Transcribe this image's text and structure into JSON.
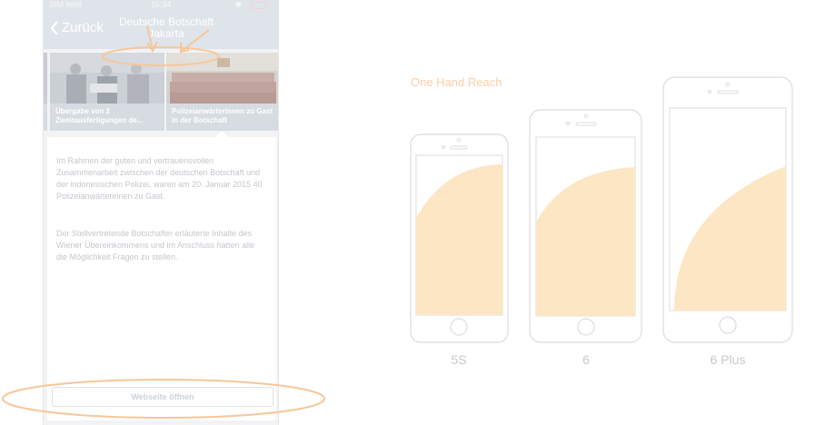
{
  "status_bar": {
    "carrier": "SIM fehlt",
    "time": "15:34"
  },
  "nav": {
    "back_label": "Zurück",
    "title": "Deutsche Botschaft Jakarta"
  },
  "carousel": {
    "cards": [
      {
        "caption": "Übergabe von 2 Zweitausfertigungen de..."
      },
      {
        "caption": "Polizeianwärterinnen zu Gast in der Botschaft"
      }
    ]
  },
  "detail": {
    "paragraph_1": "Im Rahmen der guten und vertrauensvollen Zusammenarbeit zwischen der deutschen Botschaft und der indonesischen Polizei, waren am 20. Januar 2015 40 Polizeianwärterinnen zu Gast.",
    "paragraph_2": "Der Stellvertretende Botschafter erläuterte Inhalte des Wiener Übereinkommens und im Anschluss hatten alle die Möglichkeit Fragen zu stellen.",
    "website_button": "Webseite öffnen"
  },
  "reach": {
    "title": "One Hand Reach",
    "devices": [
      {
        "label": "5S"
      },
      {
        "label": "6"
      },
      {
        "label": "6 Plus"
      }
    ],
    "colors": {
      "reach_area": "#fce6c4",
      "outline": "#d9d9de",
      "accent": "#f9cfa8"
    }
  }
}
